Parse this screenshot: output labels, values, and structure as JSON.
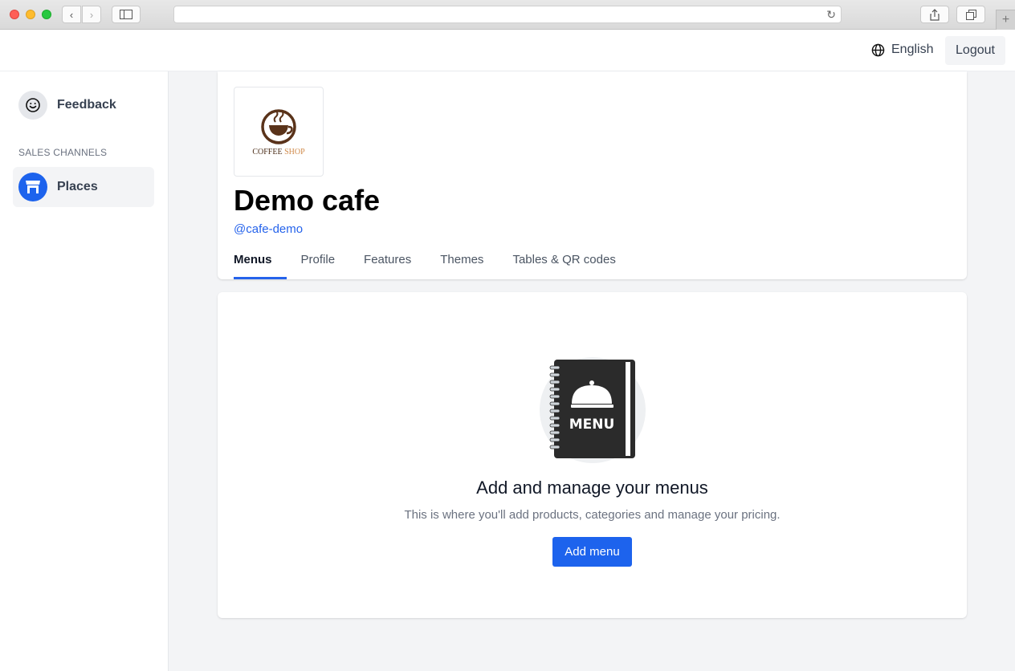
{
  "browser": {
    "address": "",
    "nav_back_glyph": "‹",
    "nav_forward_glyph": "›",
    "reload_glyph": "↻",
    "new_tab_glyph": "+"
  },
  "topbar": {
    "language_label": "English",
    "logout_label": "Logout"
  },
  "sidebar": {
    "feedback_label": "Feedback",
    "section_label": "SALES CHANNELS",
    "places_label": "Places"
  },
  "place": {
    "logo_text_dark": "COFFEE",
    "logo_text_accent": "SHOP",
    "name": "Demo cafe",
    "handle": "@cafe-demo",
    "tabs": [
      {
        "label": "Menus",
        "active": true
      },
      {
        "label": "Profile",
        "active": false
      },
      {
        "label": "Features",
        "active": false
      },
      {
        "label": "Themes",
        "active": false
      },
      {
        "label": "Tables & QR codes",
        "active": false
      }
    ]
  },
  "empty_state": {
    "illustration_text": "MENU",
    "title": "Add and manage your menus",
    "subtitle": "This is where you'll add products, categories and manage your pricing.",
    "button_label": "Add menu"
  },
  "colors": {
    "accent": "#1d63ed",
    "link": "#2563eb",
    "background": "#f3f4f6",
    "menu_book": "#2b2b2b"
  },
  "icons": {
    "language": "globe-icon",
    "feedback": "smiley-icon",
    "places": "storefront-icon",
    "logo": "coffee-cup-logo",
    "illustration": "menu-book-icon"
  }
}
